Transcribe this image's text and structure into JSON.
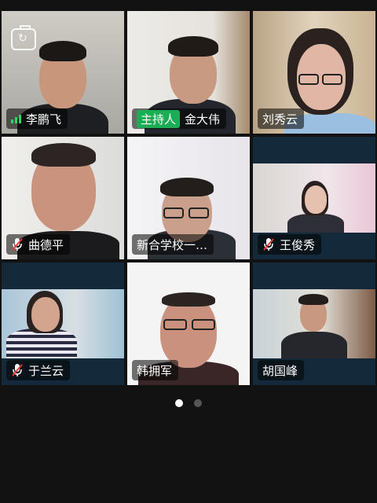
{
  "participants": [
    {
      "name": "李鹏飞",
      "host_label": "",
      "muted": false,
      "signal": true
    },
    {
      "name": "金大伟",
      "host_label": "主持人",
      "muted": false,
      "signal": false
    },
    {
      "name": "刘秀云",
      "host_label": "",
      "muted": false,
      "signal": false
    },
    {
      "name": "曲德平",
      "host_label": "",
      "muted": true,
      "signal": false
    },
    {
      "name": "新合学校一…",
      "host_label": "",
      "muted": false,
      "signal": false
    },
    {
      "name": "王俊秀",
      "host_label": "",
      "muted": true,
      "signal": false
    },
    {
      "name": "于兰云",
      "host_label": "",
      "muted": true,
      "signal": false
    },
    {
      "name": "韩拥军",
      "host_label": "",
      "muted": false,
      "signal": false
    },
    {
      "name": "胡国峰",
      "host_label": "",
      "muted": false,
      "signal": false
    }
  ],
  "icons": {
    "switch_camera": "switch-camera-icon",
    "signal": "signal-strength-icon",
    "mic_off": "mic-off-icon"
  },
  "colors": {
    "background": "#121212",
    "tile_background": "#142a3a",
    "host_badge": "#1aad55",
    "signal": "#2bd469",
    "mute_slash": "#e53935"
  },
  "pagination": {
    "pages": 2,
    "current": 1
  }
}
